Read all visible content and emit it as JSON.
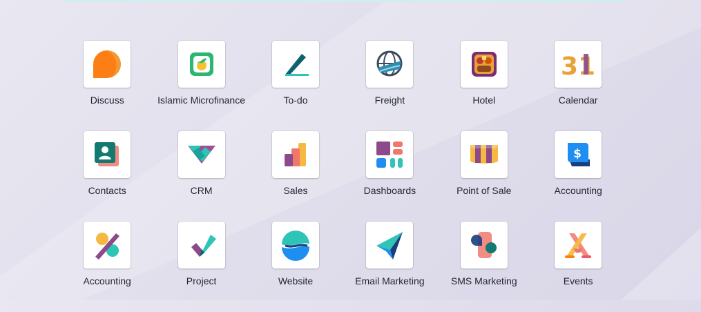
{
  "apps": [
    {
      "label": "Discuss",
      "icon": "discuss-icon"
    },
    {
      "label": "Islamic Microfinance",
      "icon": "islamic-microfinance-icon"
    },
    {
      "label": "To-do",
      "icon": "todo-icon"
    },
    {
      "label": "Freight",
      "icon": "freight-icon"
    },
    {
      "label": "Hotel",
      "icon": "hotel-icon"
    },
    {
      "label": "Calendar",
      "icon": "calendar-icon",
      "day": "31"
    },
    {
      "label": "Contacts",
      "icon": "contacts-icon"
    },
    {
      "label": "CRM",
      "icon": "crm-icon"
    },
    {
      "label": "Sales",
      "icon": "sales-icon"
    },
    {
      "label": "Dashboards",
      "icon": "dashboards-icon"
    },
    {
      "label": "Point of Sale",
      "icon": "point-of-sale-icon"
    },
    {
      "label": "Accounting",
      "icon": "accounting-icon",
      "glyph": "$"
    },
    {
      "label": "Accounting",
      "icon": "accounting-percent-icon"
    },
    {
      "label": "Project",
      "icon": "project-icon"
    },
    {
      "label": "Website",
      "icon": "website-icon"
    },
    {
      "label": "Email Marketing",
      "icon": "email-marketing-icon"
    },
    {
      "label": "SMS Marketing",
      "icon": "sms-marketing-icon"
    },
    {
      "label": "Events",
      "icon": "events-icon"
    }
  ]
}
